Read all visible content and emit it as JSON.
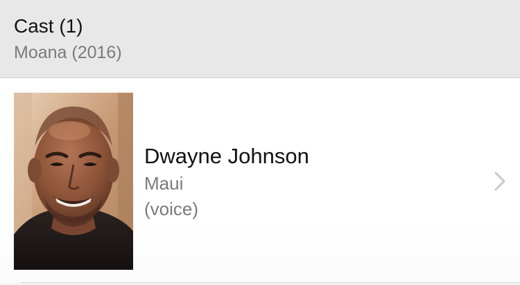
{
  "header": {
    "title": "Cast (1)",
    "subtitle": "Moana (2016)"
  },
  "cast": [
    {
      "name": "Dwayne Johnson",
      "role": "Maui",
      "note": "(voice)",
      "photo_icon": "person-headshot-photo",
      "disclosure_icon": "chevron-right-icon"
    }
  ],
  "colors": {
    "header_background": "#e8e8e8",
    "primary_text": "#111111",
    "secondary_text": "#7a7a7a",
    "chevron": "#c7c7cc",
    "separator": "#d6d6d6"
  }
}
